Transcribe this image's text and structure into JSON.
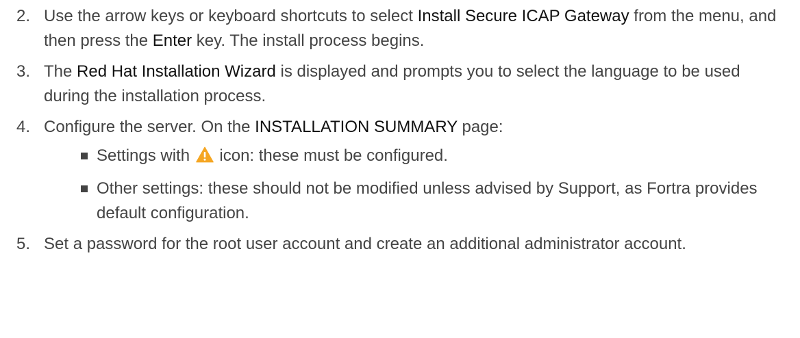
{
  "steps": [
    {
      "number": "2.",
      "parts": [
        {
          "text": "Use the arrow keys or keyboard shortcuts to select "
        },
        {
          "text": "Install Secure ICAP Gateway",
          "strong": true
        },
        {
          "text": " from the menu, and then press the "
        },
        {
          "text": "Enter",
          "strong": true
        },
        {
          "text": " key. The install process begins."
        }
      ]
    },
    {
      "number": "3.",
      "parts": [
        {
          "text": "The "
        },
        {
          "text": "Red Hat Installation Wizard",
          "strong": true
        },
        {
          "text": " is displayed and prompts you to select the language to be used during the installation process."
        }
      ]
    },
    {
      "number": "4.",
      "parts": [
        {
          "text": "Configure the server. On the "
        },
        {
          "text": "INSTALLATION SUMMARY",
          "strong": true
        },
        {
          "text": " page:"
        }
      ],
      "subitems": [
        {
          "before_icon": "Settings with ",
          "icon": "warning-icon",
          "after_icon": " icon: these must be configured."
        },
        {
          "text": "Other settings: these should not be modified unless advised by Support, as Fortra provides default configuration."
        }
      ]
    },
    {
      "number": "5.",
      "parts": [
        {
          "text": "Set a password for the root user account and create an additional administrator account."
        }
      ]
    }
  ],
  "colors": {
    "body_text": "#444444",
    "emphasis_text": "#111111",
    "warning_icon": "#F5A623"
  }
}
